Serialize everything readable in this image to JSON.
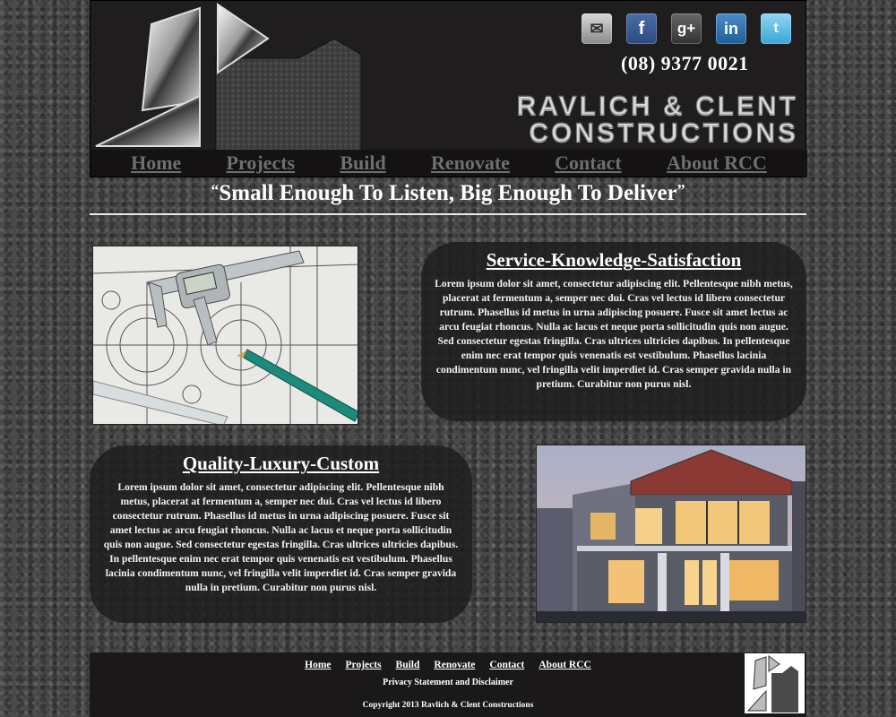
{
  "header": {
    "phone": "(08) 9377 0021",
    "brand_line1": "RAVLICH & CLENT",
    "brand_line2": "CONSTRUCTIONS",
    "social": [
      {
        "icon": "mail-icon",
        "glyph": "✉"
      },
      {
        "icon": "facebook-icon",
        "glyph": "f"
      },
      {
        "icon": "google-plus-icon",
        "glyph": "g+"
      },
      {
        "icon": "linkedin-icon",
        "glyph": "in"
      },
      {
        "icon": "twitter-icon",
        "glyph": "t"
      }
    ]
  },
  "nav": {
    "items": [
      {
        "label": "Home"
      },
      {
        "label": "Projects"
      },
      {
        "label": "Build"
      },
      {
        "label": "Renovate"
      },
      {
        "label": "Contact"
      },
      {
        "label": "About RCC"
      }
    ]
  },
  "tagline": {
    "open_quote": "“",
    "text": "Small Enough To Listen, Big Enough To Deliver",
    "close_quote": "”"
  },
  "sections": [
    {
      "title": "Service-Knowledge-Satisfaction",
      "body": "Lorem ipsum dolor sit amet, consectetur adipiscing elit. Pellentesque nibh metus, placerat at fermentum a, semper nec dui. Cras vel lectus id libero consectetur rutrum. Phasellus id metus in urna adipiscing posuere. Fusce sit amet lectus ac arcu feugiat rhoncus. Nulla ac lacus et neque porta sollicitudin quis non augue. Sed consectetur egestas fringilla. Cras ultrices ultricies dapibus. In pellentesque enim nec erat tempor quis venenatis est vestibulum. Phasellus lacinia condimentum nunc, vel fringilla velit imperdiet id. Cras semper gravida nulla in pretium. Curabitur non purus nisl."
    },
    {
      "title": "Quality-Luxury-Custom",
      "body": "Lorem ipsum dolor sit amet, consectetur adipiscing elit. Pellentesque nibh metus, placerat at fermentum a, semper nec dui. Cras vel lectus id libero consectetur rutrum. Phasellus id metus in urna adipiscing posuere. Fusce sit amet lectus ac arcu feugiat rhoncus. Nulla ac lacus et neque porta sollicitudin quis non augue. Sed consectetur egestas fringilla. Cras ultrices ultricies dapibus. In pellentesque enim nec erat tempor quis venenatis est vestibulum. Phasellus lacinia condimentum nunc, vel fringilla velit imperdiet id. Cras semper gravida nulla in pretium. Curabitur non purus nisl."
    }
  ],
  "footer": {
    "links": [
      {
        "label": "Home"
      },
      {
        "label": "Projects"
      },
      {
        "label": "Build"
      },
      {
        "label": "Renovate"
      },
      {
        "label": "Contact"
      },
      {
        "label": "About RCC"
      }
    ],
    "privacy": "Privacy Statement and Disclaimer",
    "copyright": "Copyright 2013 Ravlich & Clent Constructions"
  },
  "colors": {
    "header_bg": "#1f1d1d",
    "nav_link": "#6f6f6f",
    "panel_bg": "#1c1c1c",
    "text": "#ffffff"
  }
}
